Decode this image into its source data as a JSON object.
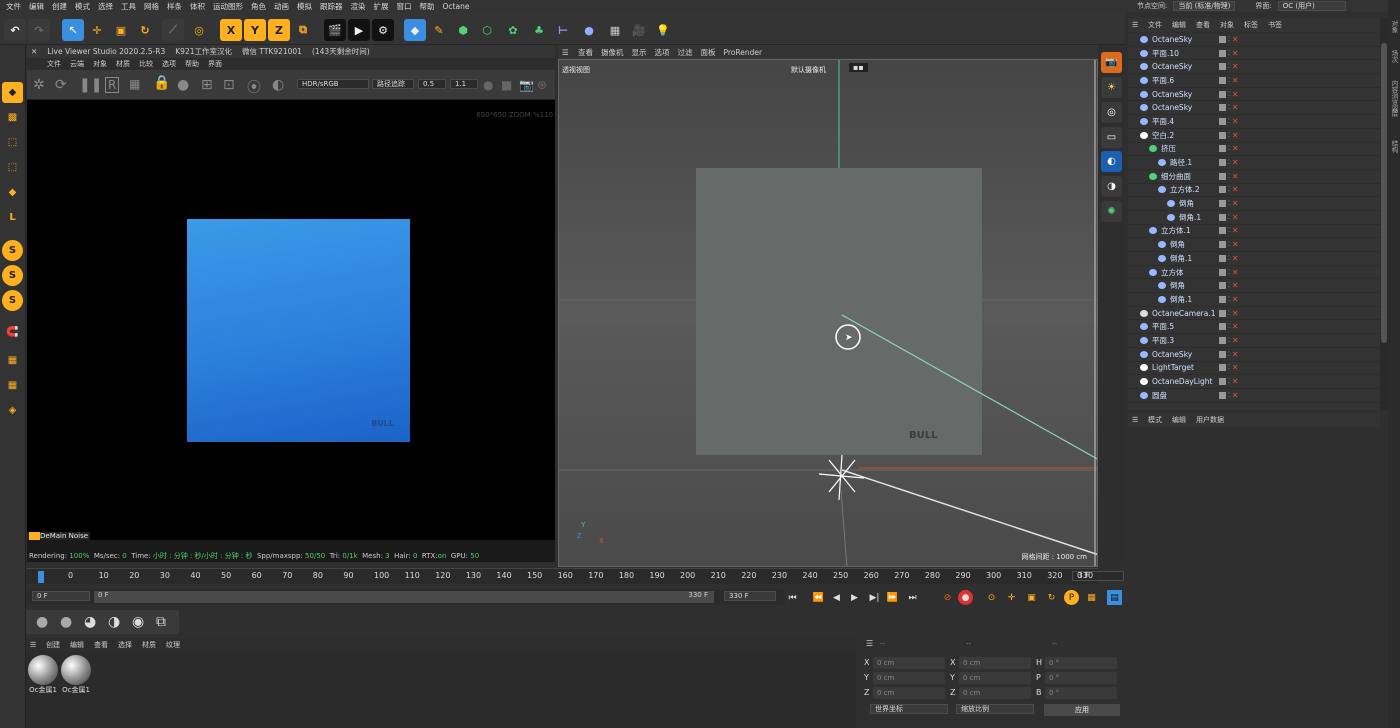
{
  "menubar": [
    "文件",
    "编辑",
    "创建",
    "模式",
    "选择",
    "工具",
    "网格",
    "样条",
    "体积",
    "运动图形",
    "角色",
    "动画",
    "模拟",
    "跟踪器",
    "渲染",
    "扩展",
    "窗口",
    "帮助",
    "Octane"
  ],
  "node_space": {
    "label": "节点空间:",
    "value": "当前 (标准/物理)"
  },
  "interface": {
    "label": "界面:",
    "value": "OC (用户)"
  },
  "live_viewer": {
    "title": "Live Viewer Studio 2020.2.5-R3",
    "sub": "K921工作室汉化",
    "wechat": "微信 TTK921001",
    "days": "(143天剩余时间)",
    "menu": [
      "文件",
      "云端",
      "对象",
      "材质",
      "比较",
      "选项",
      "帮助",
      "界面"
    ],
    "colorspace": "HDR/sRGB",
    "kernel": "路径追踪",
    "val1": "0.5",
    "val2": "1.1",
    "zoom": "650*650 ZOOM:%110",
    "denoise": "DeMain Noise",
    "status": {
      "rendering_label": "Rendering:",
      "rendering": "100%",
      "ms_label": "Ms/sec:",
      "ms": "0",
      "time_label": "Time:",
      "time": "小时 : 分钟 : 秒/小时 : 分钟 : 秒",
      "spp_label": "Spp/maxspp:",
      "spp": "50/50",
      "tri_label": "Tri:",
      "tri": "0/1k",
      "mesh_label": "Mesh:",
      "mesh": "3",
      "hair_label": "Hair:",
      "hair": "0",
      "rtx_label": "RTX:",
      "rtx": "on",
      "gpu_label": "GPU:",
      "gpu": "50"
    }
  },
  "logo_text": "BULL",
  "viewport": {
    "menu": [
      "查看",
      "摄像机",
      "显示",
      "选项",
      "过滤",
      "面板",
      "ProRender"
    ],
    "label": "透视视图",
    "camera": "默认摄像机",
    "grid": "网格间距 : 1000 cm"
  },
  "object_manager": {
    "menu": [
      "文件",
      "编辑",
      "查看",
      "对象",
      "标签",
      "书签"
    ],
    "rows": [
      {
        "name": "OctaneSky",
        "indent": 0,
        "icon": "sky"
      },
      {
        "name": "平面.10",
        "indent": 0,
        "icon": "plane"
      },
      {
        "name": "OctaneSky",
        "indent": 0,
        "icon": "sky"
      },
      {
        "name": "平面.6",
        "indent": 0,
        "icon": "plane"
      },
      {
        "name": "OctaneSky",
        "indent": 0,
        "icon": "sky"
      },
      {
        "name": "OctaneSky",
        "indent": 0,
        "icon": "sky"
      },
      {
        "name": "平面.4",
        "indent": 0,
        "icon": "plane"
      },
      {
        "name": "空白.2",
        "indent": 0,
        "icon": "null"
      },
      {
        "name": "挤压",
        "indent": 1,
        "icon": "extrude"
      },
      {
        "name": "路径.1",
        "indent": 2,
        "icon": "spline"
      },
      {
        "name": "细分曲面",
        "indent": 1,
        "icon": "subdiv"
      },
      {
        "name": "立方体.2",
        "indent": 2,
        "icon": "cube"
      },
      {
        "name": "倒角",
        "indent": 3,
        "icon": "bevel"
      },
      {
        "name": "倒角.1",
        "indent": 3,
        "icon": "bevel"
      },
      {
        "name": "立方体.1",
        "indent": 1,
        "icon": "cube"
      },
      {
        "name": "倒角",
        "indent": 2,
        "icon": "bevel"
      },
      {
        "name": "倒角.1",
        "indent": 2,
        "icon": "bevel"
      },
      {
        "name": "立方体",
        "indent": 1,
        "icon": "cube"
      },
      {
        "name": "倒角",
        "indent": 2,
        "icon": "bevel"
      },
      {
        "name": "倒角.1",
        "indent": 2,
        "icon": "bevel"
      },
      {
        "name": "OctaneCamera.1",
        "indent": 0,
        "icon": "camera"
      },
      {
        "name": "平面.5",
        "indent": 0,
        "icon": "plane"
      },
      {
        "name": "平面.3",
        "indent": 0,
        "icon": "plane"
      },
      {
        "name": "OctaneSky",
        "indent": 0,
        "icon": "sky"
      },
      {
        "name": "LightTarget",
        "indent": 0,
        "icon": "null"
      },
      {
        "name": "OctaneDayLight",
        "indent": 0,
        "icon": "light"
      },
      {
        "name": "圆盘",
        "indent": 0,
        "icon": "disc"
      }
    ]
  },
  "attributes": {
    "menu": [
      "模式",
      "编辑",
      "用户数据"
    ]
  },
  "right_strip": [
    "对象",
    "场次",
    "内容浏览器",
    "层",
    "结构"
  ],
  "timeline": {
    "ticks": [
      "0",
      "10",
      "20",
      "30",
      "40",
      "50",
      "60",
      "70",
      "80",
      "90",
      "100",
      "110",
      "120",
      "130",
      "140",
      "150",
      "160",
      "170",
      "180",
      "190",
      "200",
      "210",
      "220",
      "230",
      "240",
      "250",
      "260",
      "270",
      "280",
      "290",
      "300",
      "310",
      "320",
      "330"
    ],
    "current": "0 F",
    "start": "0 F",
    "bar_start": "0 F",
    "end": "330 F",
    "end2": "330 F"
  },
  "materials": {
    "menu": [
      "创建",
      "编辑",
      "查看",
      "选择",
      "材质",
      "纹理"
    ],
    "items": [
      "Oc金属1",
      "Oc金属1"
    ]
  },
  "coords": {
    "headers": [
      "--",
      "--",
      "--"
    ],
    "rows": [
      {
        "a": "X",
        "av": "0 cm",
        "b": "X",
        "bv": "0 cm",
        "c": "H",
        "cv": "0 °"
      },
      {
        "a": "Y",
        "av": "0 cm",
        "b": "Y",
        "bv": "0 cm",
        "c": "P",
        "cv": "0 °"
      },
      {
        "a": "Z",
        "av": "0 cm",
        "b": "Z",
        "bv": "0 cm",
        "c": "B",
        "cv": "0 °"
      }
    ],
    "world": "世界坐标",
    "scale": "缩放比例",
    "apply": "应用"
  },
  "colors": {
    "accent": "#3a8fe0",
    "render_top": "#3b99e6",
    "render_bottom": "#1c63c9",
    "viewport_bg": "#4b4b4b",
    "green_line": "#52c39a"
  }
}
